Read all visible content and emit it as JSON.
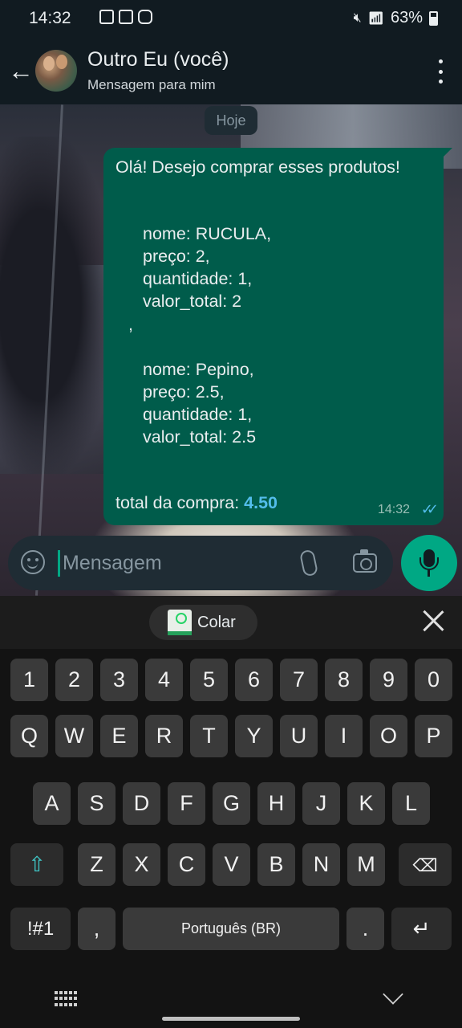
{
  "status_bar": {
    "time": "14:32",
    "battery": "63%"
  },
  "header": {
    "title": "Outro Eu (você)",
    "subtitle": "Mensagem para mim"
  },
  "date_chip": "Hoje",
  "message": {
    "greeting": "Olá! Desejo comprar esses produtos!",
    "item1": [
      "nome: RUCULA,",
      "preço: 2,",
      "quantidade: 1,",
      "valor_total: 2"
    ],
    "separator": ",",
    "item2": [
      "nome: Pepino,",
      "preço: 2.5,",
      "quantidade: 1,",
      "valor_total: 2.5"
    ],
    "total_label": "total da compra: ",
    "total_value": "4.50",
    "time": "14:32",
    "status": "read"
  },
  "composer": {
    "placeholder": "Mensagem"
  },
  "keyboard": {
    "paste_label": "Colar",
    "number_row": [
      "1",
      "2",
      "3",
      "4",
      "5",
      "6",
      "7",
      "8",
      "9",
      "0"
    ],
    "row1": [
      "Q",
      "W",
      "E",
      "R",
      "T",
      "Y",
      "U",
      "I",
      "O",
      "P"
    ],
    "row2": [
      "A",
      "S",
      "D",
      "F",
      "G",
      "H",
      "J",
      "K",
      "L"
    ],
    "row3": [
      "Z",
      "X",
      "C",
      "V",
      "B",
      "N",
      "M"
    ],
    "symbols_label": "!#1",
    "comma_label": ",",
    "space_label": "Português (BR)",
    "period_label": "."
  },
  "colors": {
    "bubble": "#005c4b",
    "accent": "#00a884",
    "tick_blue": "#53bdeb",
    "background": "#111b21"
  }
}
